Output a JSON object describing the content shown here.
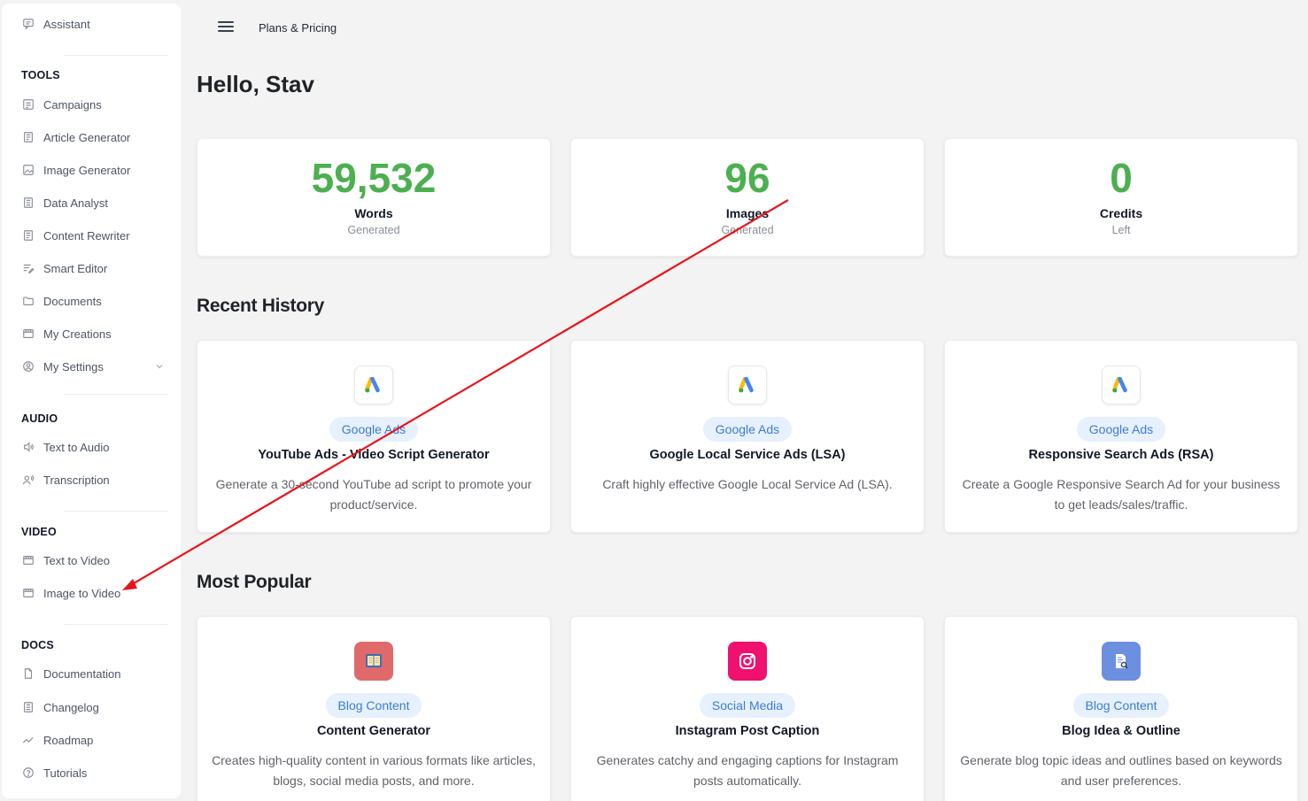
{
  "sidebar": {
    "assistant": "Assistant",
    "sections": {
      "tools": "TOOLS",
      "audio": "AUDIO",
      "video": "VIDEO",
      "docs": "DOCS"
    },
    "tools": [
      "Campaigns",
      "Article Generator",
      "Image Generator",
      "Data Analyst",
      "Content Rewriter",
      "Smart Editor",
      "Documents",
      "My Creations",
      "My Settings"
    ],
    "audio": [
      "Text to Audio",
      "Transcription"
    ],
    "video": [
      "Text to Video",
      "Image to Video"
    ],
    "docs": [
      "Documentation",
      "Changelog",
      "Roadmap",
      "Tutorials"
    ]
  },
  "header": {
    "breadcrumb": "Plans & Pricing"
  },
  "greeting": "Hello, Stav",
  "stats": [
    {
      "value": "59,532",
      "label": "Words",
      "sub": "Generated"
    },
    {
      "value": "96",
      "label": "Images",
      "sub": "Generated"
    },
    {
      "value": "0",
      "label": "Credits",
      "sub": "Left"
    }
  ],
  "recent_history": {
    "heading": "Recent History",
    "items": [
      {
        "badge": "Google Ads",
        "title": "YouTube Ads - Video Script Generator",
        "desc": "Generate a 30-second YouTube ad script to promote your product/service.",
        "icon": "google-ads-icon"
      },
      {
        "badge": "Google Ads",
        "title": "Google Local Service Ads (LSA)",
        "desc": "Craft highly effective Google Local Service Ad (LSA).",
        "icon": "google-ads-icon"
      },
      {
        "badge": "Google Ads",
        "title": "Responsive Search Ads (RSA)",
        "desc": "Create a Google Responsive Search Ad for your business to get leads/sales/traffic.",
        "icon": "google-ads-icon"
      }
    ]
  },
  "most_popular": {
    "heading": "Most Popular",
    "items": [
      {
        "badge": "Blog Content",
        "title": "Content Generator",
        "desc": "Creates high-quality content in various formats like articles, blogs, social media posts, and more.",
        "icon": "book-icon"
      },
      {
        "badge": "Social Media",
        "title": "Instagram Post Caption",
        "desc": "Generates catchy and engaging captions for Instagram posts automatically.",
        "icon": "instagram-icon"
      },
      {
        "badge": "Blog Content",
        "title": "Blog Idea & Outline",
        "desc": "Generate blog topic ideas and outlines based on keywords and user preferences.",
        "icon": "document-search-icon"
      }
    ]
  },
  "colors": {
    "stat_green": "#4caf50",
    "badge_bg": "#e7f1fd",
    "badge_text": "#3a7bd5",
    "annotation_arrow": "#e8141b"
  }
}
